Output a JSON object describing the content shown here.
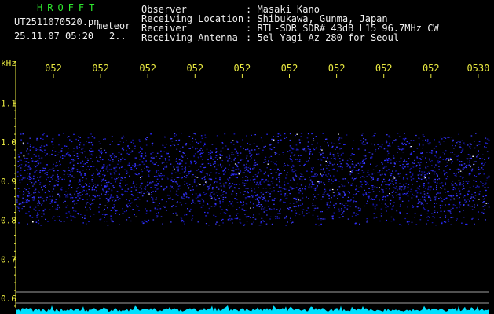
{
  "header": {
    "brand": "HROFFT",
    "filename": "UT2511070520.pn",
    "meteor_label": "meteor",
    "datetime": "25.11.07 05:20",
    "count": "2..",
    "fields": [
      {
        "label": "Observer",
        "value": ": Masaki Kano"
      },
      {
        "label": "Receiving Location",
        "value": ": Shibukawa, Gunma, Japan"
      },
      {
        "label": "Receiver",
        "value": ": RTL-SDR SDR# 43dB L15 96.7MHz CW"
      },
      {
        "label": "Receiving Antenna",
        "value": ": 5el Yagi Az 280 for Seoul"
      }
    ]
  },
  "chart_data": {
    "type": "heatmap",
    "ylabel": "kHz",
    "y_ticks": [
      "1.1",
      "1.0",
      "0.9",
      "0.8",
      "0.7",
      "0.6"
    ],
    "x_ticks": [
      "052",
      "052",
      "052",
      "052",
      "052",
      "052",
      "052",
      "052",
      "052",
      "0530"
    ],
    "signal_band_khz": [
      0.8,
      1.0
    ],
    "ylim": [
      0.58,
      1.15
    ]
  },
  "colors": {
    "background": "#000000",
    "signal": "#2a2aff",
    "bright": "#ffffff",
    "axis_label": "#e8e840",
    "brand": "#2ee82e",
    "noise_floor": "#00e0ff"
  }
}
